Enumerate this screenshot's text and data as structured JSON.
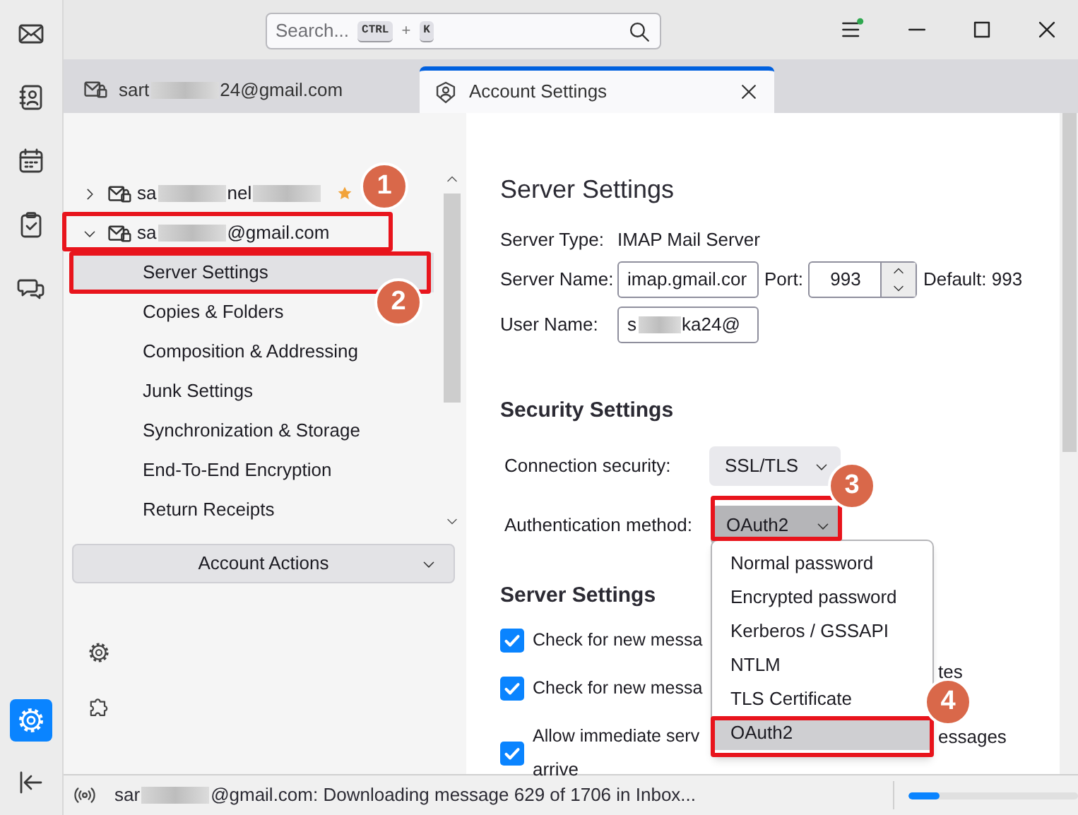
{
  "rail": {
    "items": [
      {
        "kind": "mail",
        "selected": false
      },
      {
        "kind": "contacts",
        "selected": false
      },
      {
        "kind": "calendar",
        "selected": false
      },
      {
        "kind": "tasks",
        "selected": false
      },
      {
        "kind": "chat",
        "selected": false
      }
    ],
    "bottom": [
      {
        "kind": "settings",
        "selected": true
      },
      {
        "kind": "collapse",
        "selected": false
      }
    ]
  },
  "search": {
    "placeholder": "Search...",
    "keys": [
      "CTRL",
      "K"
    ],
    "plus": "+"
  },
  "tabs": [
    {
      "kind": "mail",
      "parts": [
        {
          "kind": "text",
          "text": "sart"
        },
        {
          "kind": "blur"
        },
        {
          "kind": "text",
          "text": "24@gmail.com"
        }
      ],
      "selected": false
    },
    {
      "kind": "settings",
      "parts": [
        {
          "kind": "text",
          "text": "Account Settings"
        }
      ],
      "selected": true
    }
  ],
  "accounts": [
    {
      "parts": [
        {
          "kind": "text",
          "text": "sa"
        },
        {
          "kind": "blur"
        },
        {
          "kind": "text",
          "text": "nel"
        },
        {
          "kind": "blur"
        }
      ],
      "expanded": false,
      "default": true
    },
    {
      "parts": [
        {
          "kind": "text",
          "text": "sa"
        },
        {
          "kind": "blur"
        },
        {
          "kind": "text",
          "text": "@gmail.com"
        }
      ],
      "expanded": true,
      "default": false,
      "children": [
        {
          "label": "Server Settings",
          "selected": true
        },
        {
          "label": "Copies & Folders",
          "selected": false
        },
        {
          "label": "Composition & Addressing",
          "selected": false
        },
        {
          "label": "Junk Settings",
          "selected": false
        },
        {
          "label": "Synchronization & Storage",
          "selected": false
        },
        {
          "label": "End-To-End Encryption",
          "selected": false
        },
        {
          "label": "Return Receipts",
          "selected": false
        }
      ]
    }
  ],
  "account_actions": "Account Actions",
  "server": {
    "heading": "Server Settings",
    "type_label": "Server Type:",
    "type_value": "IMAP Mail Server",
    "name_label": "Server Name:",
    "name_value": "imap.gmail.cor",
    "port_label": "Port:",
    "port_value": "993",
    "default": "Default: 993",
    "user_label": "User Name:",
    "user_parts": [
      {
        "kind": "text",
        "text": "s"
      },
      {
        "kind": "blur"
      },
      {
        "kind": "text",
        "text": "ka24@"
      }
    ]
  },
  "security": {
    "heading": "Security Settings",
    "connection_label": "Connection security:",
    "connection_value": "SSL/TLS",
    "auth_label": "Authentication method:",
    "auth_value": "OAuth2",
    "auth_open": true,
    "options": [
      {
        "label": "Normal password",
        "selected": false
      },
      {
        "label": "Encrypted password",
        "selected": false
      },
      {
        "label": "Kerberos / GSSAPI",
        "selected": false
      },
      {
        "label": "NTLM",
        "selected": false
      },
      {
        "label": "TLS Certificate",
        "selected": false
      },
      {
        "label": "OAuth2",
        "selected": true
      }
    ]
  },
  "server_options": {
    "heading": "Server Settings",
    "checks": [
      {
        "text": "Check for new messa",
        "checked": true
      },
      {
        "text": "Check for new messa",
        "tail": "tes",
        "checked": true
      },
      {
        "text": "Allow immediate serv",
        "tail": "essages",
        "continuation": "arrive",
        "checked": true
      }
    ]
  },
  "status_bar": {
    "parts": [
      {
        "kind": "text",
        "text": "sar"
      },
      {
        "kind": "blur"
      },
      {
        "kind": "text",
        "text": "@gmail.com: Downloading message 629 of 1706 in Inbox..."
      }
    ],
    "level": 0.18
  },
  "callouts": [
    {
      "number": "1"
    },
    {
      "number": "2"
    },
    {
      "number": "3"
    },
    {
      "number": "4"
    }
  ]
}
